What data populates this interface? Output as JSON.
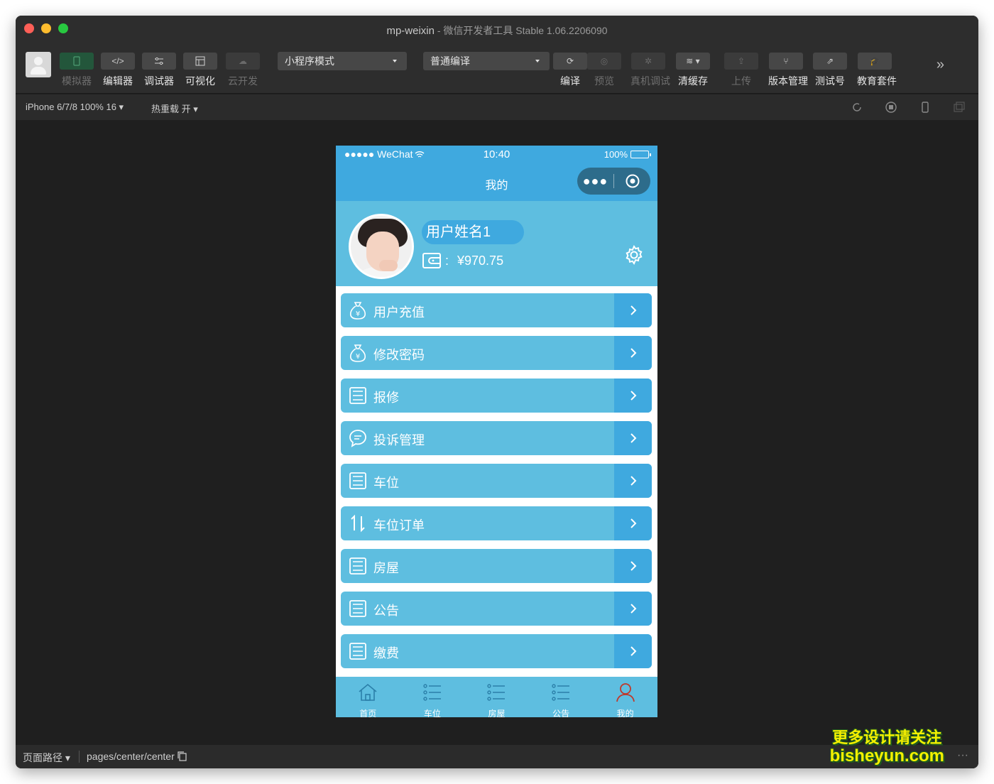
{
  "window": {
    "title": "mp-weixin",
    "subtitle": "微信开发者工具 Stable 1.06.2206090"
  },
  "toolbar": {
    "simulator": "模拟器",
    "editor": "编辑器",
    "debugger": "调试器",
    "visual": "可视化",
    "cloud": "云开发",
    "mode_select": "小程序模式",
    "compile_select": "普通编译",
    "compile": "编译",
    "preview": "预览",
    "real_debug": "真机调试",
    "clear_cache": "清缓存",
    "upload": "上传",
    "version": "版本管理",
    "test_account": "测试号",
    "edu": "教育套件"
  },
  "subbar": {
    "device": "iPhone 6/7/8 100% 16",
    "hot_reload": "热重载 开"
  },
  "bottombar": {
    "route_label": "页面路径",
    "route": "pages/center/center"
  },
  "watermark": {
    "line1": "更多设计请关注",
    "line2": "bisheyun.com"
  },
  "phone": {
    "status": {
      "carrier": "●●●●● WeChat",
      "time": "10:40",
      "battery": "100%"
    },
    "nav_title": "我的",
    "user": {
      "name": "用户姓名1",
      "balance": "¥970.75",
      "colon": ":"
    },
    "menu": [
      {
        "label": "用户充值",
        "icon": "money-bag-icon"
      },
      {
        "label": "修改密码",
        "icon": "money-bag-icon"
      },
      {
        "label": "报修",
        "icon": "list-card-icon"
      },
      {
        "label": "投诉管理",
        "icon": "chat-bubble-icon"
      },
      {
        "label": "车位",
        "icon": "list-card-icon"
      },
      {
        "label": "车位订单",
        "icon": "sort-arrows-icon"
      },
      {
        "label": "房屋",
        "icon": "list-card-icon"
      },
      {
        "label": "公告",
        "icon": "list-card-icon"
      },
      {
        "label": "缴费",
        "icon": "list-card-icon"
      }
    ],
    "tabs": [
      {
        "label": "首页",
        "icon": "home-icon"
      },
      {
        "label": "车位",
        "icon": "list-icon"
      },
      {
        "label": "房屋",
        "icon": "list-icon"
      },
      {
        "label": "公告",
        "icon": "list-icon"
      },
      {
        "label": "我的",
        "icon": "user-icon",
        "active": true
      }
    ]
  },
  "colors": {
    "primary": "#3fa9df",
    "light": "#5ebee0",
    "active_tab_icon": "#c0392b"
  }
}
